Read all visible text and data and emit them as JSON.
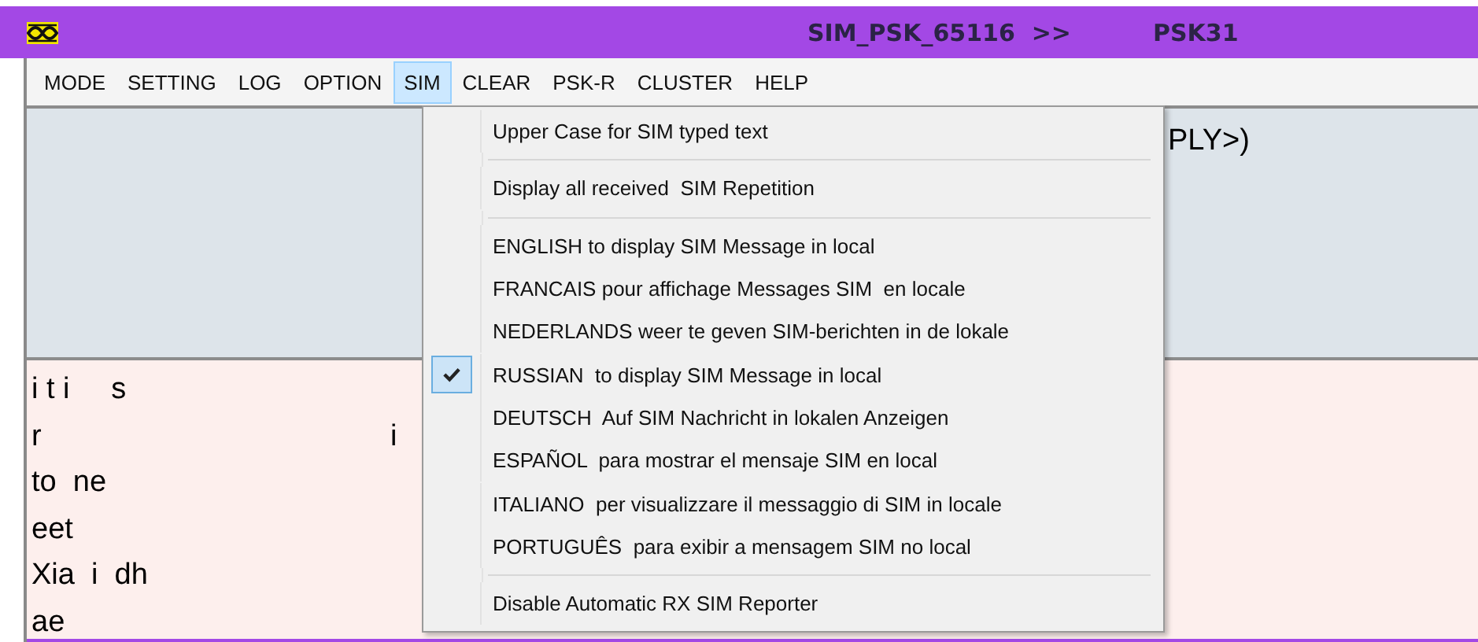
{
  "window": {
    "title": "SIM_PSK_65116  >>",
    "mode": "PSK31"
  },
  "menu_bar": [
    {
      "label": "MODE",
      "selected": false
    },
    {
      "label": "SETTING",
      "selected": false
    },
    {
      "label": "LOG",
      "selected": false
    },
    {
      "label": "OPTION",
      "selected": false
    },
    {
      "label": "SIM",
      "selected": true
    },
    {
      "label": "CLEAR",
      "selected": false
    },
    {
      "label": "PSK-R",
      "selected": false
    },
    {
      "label": "CLUSTER",
      "selected": false
    },
    {
      "label": "HELP",
      "selected": false
    }
  ],
  "sim_menu": [
    {
      "kind": "option",
      "label": "Upper Case for SIM typed text",
      "checked": false
    },
    {
      "kind": "separator"
    },
    {
      "kind": "option",
      "label": "Display all received  SIM Repetition",
      "checked": false
    },
    {
      "kind": "separator"
    },
    {
      "kind": "option",
      "label": "ENGLISH to display SIM Message in local",
      "checked": false
    },
    {
      "kind": "option",
      "label": "FRANCAIS pour affichage Messages SIM  en locale",
      "checked": false
    },
    {
      "kind": "option",
      "label": "NEDERLANDS weer te geven SIM-berichten in de lokale",
      "checked": false
    },
    {
      "kind": "option",
      "label": "RUSSIAN  to display SIM Message in local",
      "checked": true
    },
    {
      "kind": "option",
      "label": "DEUTSCH  Auf SIM Nachricht in lokalen Anzeigen",
      "checked": false
    },
    {
      "kind": "option",
      "label": "ESPAÑOL  para mostrar el mensaje SIM en local",
      "checked": false
    },
    {
      "kind": "option",
      "label": "ITALIANO  per visualizzare il messaggio di SIM in locale",
      "checked": false
    },
    {
      "kind": "option",
      "label": "PORTUGUÊS  para exibir a mensagem SIM no local",
      "checked": false
    },
    {
      "kind": "separator"
    },
    {
      "kind": "option",
      "label": "Disable Automatic RX SIM Reporter",
      "checked": false
    }
  ],
  "tx_panel": {
    "text": "PLY>)"
  },
  "rx_panel": {
    "lines": [
      "i t i     s",
      "r                                          i",
      "to  ne",
      "eet",
      "Xia  i  dh",
      "ae"
    ]
  }
}
